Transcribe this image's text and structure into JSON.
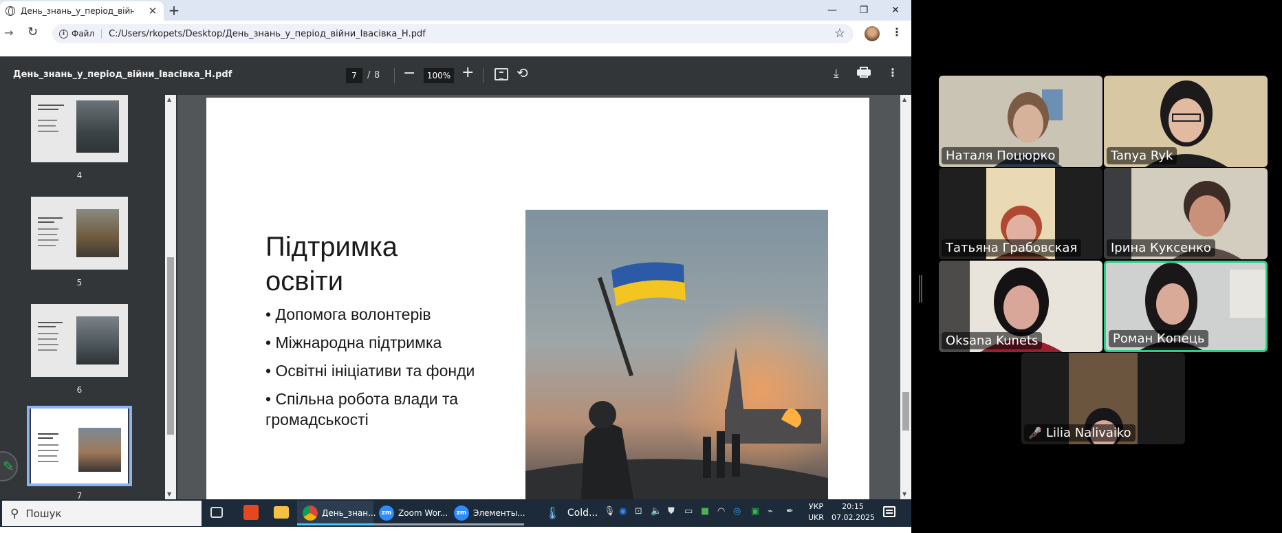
{
  "browser": {
    "tab_title": "День_знань_у_період_війни_Іє",
    "url_chip": "Файл",
    "url": "C:/Users/rkopets/Desktop/День_знань_у_період_війни_Івасівка_Н.pdf"
  },
  "pdf": {
    "filename": "День_знань_у_період_війни_Івасівка_Н.pdf",
    "current_page": "7",
    "page_sep": "/",
    "total_pages": "8",
    "zoom": "100%",
    "thumbnails": [
      {
        "label": "4",
        "title": "Формати навчання під час війни"
      },
      {
        "label": "5",
        "title": "Роль учителів і батьків"
      },
      {
        "label": "6",
        "title": "Мотивація до навчання"
      },
      {
        "label": "7",
        "title": "Підтримка освіти"
      }
    ]
  },
  "slide": {
    "title_line1": "Підтримка",
    "title_line2": "освіти",
    "bullets": [
      "• Допомога  волонтерів",
      "• Міжнародна  підтримка",
      "• Освітні ініціативи та фонди",
      "• Спільна робота влади та громадськості"
    ]
  },
  "taskbar": {
    "search_placeholder": "Пошук",
    "apps": [
      {
        "label": "День_знан..."
      },
      {
        "label": "Zoom Wor..."
      },
      {
        "label": "Элементы..."
      },
      {
        "label": "Cold..."
      }
    ],
    "lang_top": "УКР",
    "lang_bottom": "UKR",
    "time": "20:15",
    "date": "07.02.2025"
  },
  "zoom": {
    "participants": [
      {
        "name": "Наталя Поцюрко"
      },
      {
        "name": "Tanya Ryk"
      },
      {
        "name": "Татьяна Грабовская"
      },
      {
        "name": "Ірина Куксенко"
      },
      {
        "name": "Oksana Kunets"
      },
      {
        "name": "Роман Копець"
      },
      {
        "name": "Lilia Nalivaiko"
      }
    ]
  },
  "colors": {
    "pdf_toolbar": "#323639",
    "pdf_bg": "#525659",
    "taskbar": "#1c2a3a",
    "speaker_border": "#23d18b",
    "selection": "#8ab4f8"
  }
}
